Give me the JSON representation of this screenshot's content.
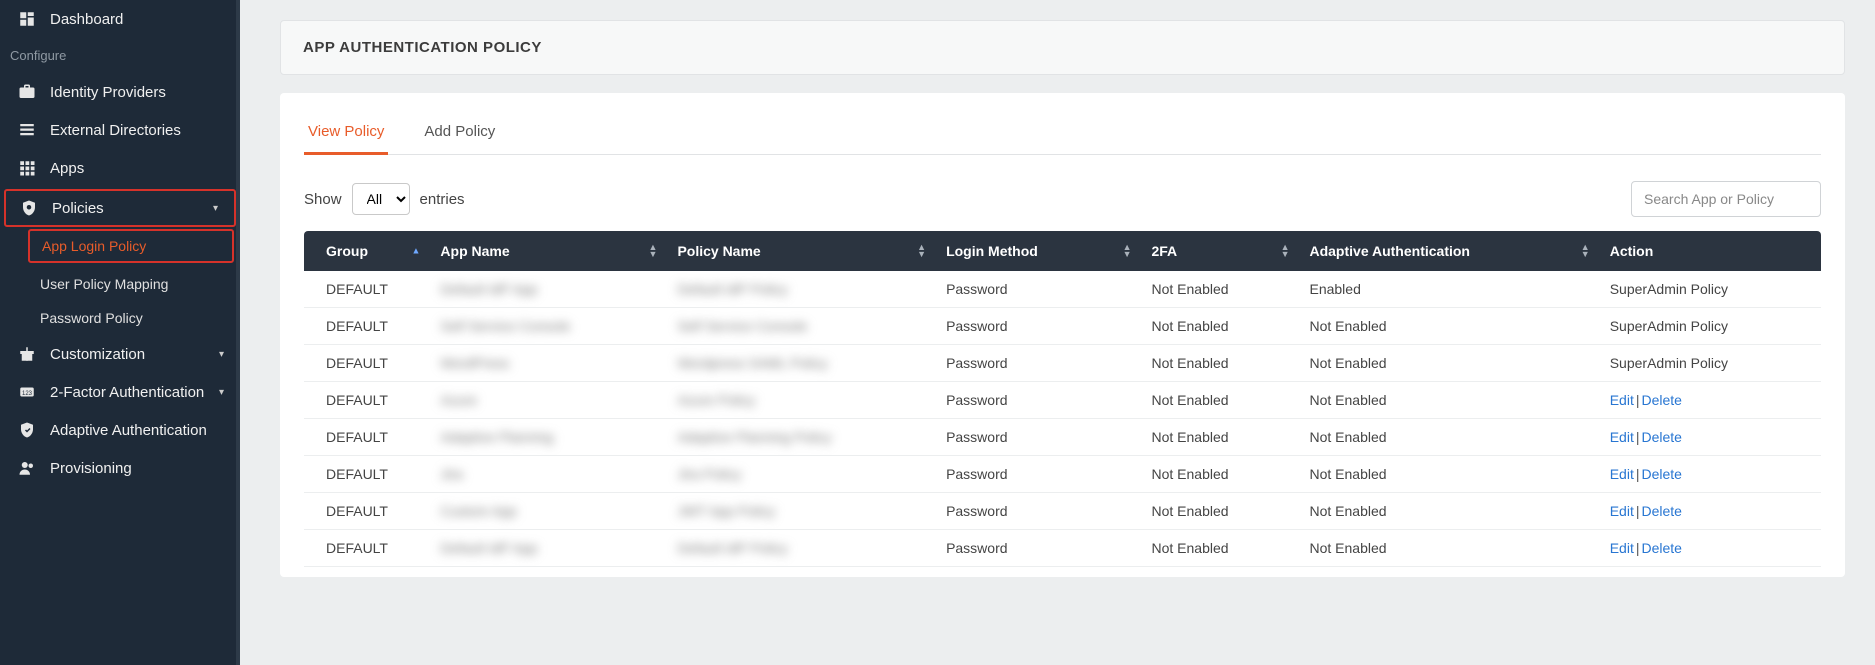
{
  "sidebar": {
    "dashboard": "Dashboard",
    "configure_label": "Configure",
    "identity_providers": "Identity Providers",
    "external_directories": "External Directories",
    "apps": "Apps",
    "policies": "Policies",
    "policies_sub": {
      "app_login": "App Login Policy",
      "user_policy_mapping": "User Policy Mapping",
      "password_policy": "Password Policy"
    },
    "customization": "Customization",
    "two_factor": "2-Factor Authentication",
    "adaptive_auth": "Adaptive Authentication",
    "provisioning": "Provisioning"
  },
  "header": {
    "title": "APP AUTHENTICATION POLICY"
  },
  "tabs": {
    "view": "View Policy",
    "add": "Add Policy"
  },
  "show": {
    "label_before": "Show",
    "value": "All",
    "label_after": "entries"
  },
  "search": {
    "placeholder": "Search App or Policy"
  },
  "columns": {
    "group": "Group",
    "app_name": "App Name",
    "policy_name": "Policy Name",
    "login_method": "Login Method",
    "two_fa": "2FA",
    "adaptive": "Adaptive Authentication",
    "action": "Action"
  },
  "status": {
    "not_enabled": "Not Enabled",
    "enabled": "Enabled"
  },
  "actions": {
    "edit": "Edit",
    "delete": "Delete"
  },
  "rows": [
    {
      "group": "DEFAULT",
      "app": "Default IdP App",
      "policy": "Default IdP Policy",
      "login": "Password",
      "twofa": "not_enabled",
      "adaptive": "enabled",
      "action_type": "text",
      "action_text": "SuperAdmin Policy"
    },
    {
      "group": "DEFAULT",
      "app": "Self Service Console",
      "policy": "Self Service Console",
      "login": "Password",
      "twofa": "not_enabled",
      "adaptive": "not_enabled",
      "action_type": "text",
      "action_text": "SuperAdmin Policy"
    },
    {
      "group": "DEFAULT",
      "app": "WordPress",
      "policy": "Wordpress SAML Policy",
      "login": "Password",
      "twofa": "not_enabled",
      "adaptive": "not_enabled",
      "action_type": "text",
      "action_text": "SuperAdmin Policy"
    },
    {
      "group": "DEFAULT",
      "app": "Azure",
      "policy": "Azure Policy",
      "login": "Password",
      "twofa": "not_enabled",
      "adaptive": "not_enabled",
      "action_type": "links"
    },
    {
      "group": "DEFAULT",
      "app": "Adaptive Planning",
      "policy": "Adaptive Planning Policy",
      "login": "Password",
      "twofa": "not_enabled",
      "adaptive": "not_enabled",
      "action_type": "links"
    },
    {
      "group": "DEFAULT",
      "app": "Jira",
      "policy": "Jira Policy",
      "login": "Password",
      "twofa": "not_enabled",
      "adaptive": "not_enabled",
      "action_type": "links"
    },
    {
      "group": "DEFAULT",
      "app": "Custom App",
      "policy": "JWT App Policy",
      "login": "Password",
      "twofa": "not_enabled",
      "adaptive": "not_enabled",
      "action_type": "links"
    },
    {
      "group": "DEFAULT",
      "app": "Default IdP App",
      "policy": "Default IdP Policy",
      "login": "Password",
      "twofa": "not_enabled",
      "adaptive": "not_enabled",
      "action_type": "links"
    }
  ]
}
